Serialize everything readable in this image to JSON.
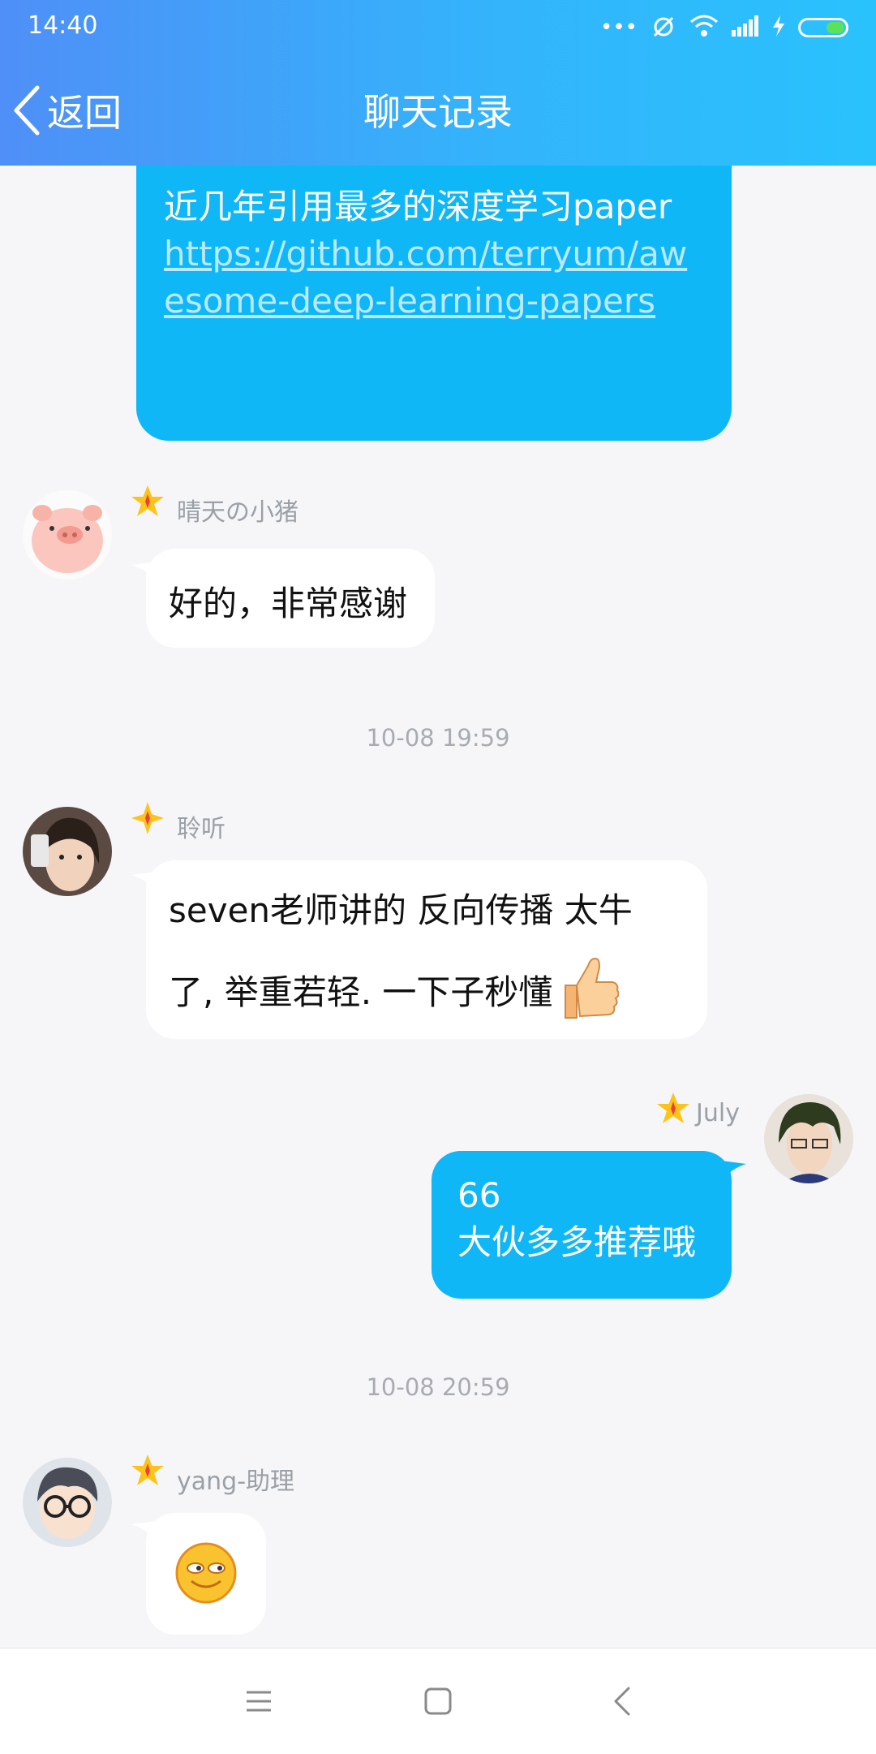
{
  "status_bar": {
    "time": "14:40"
  },
  "header": {
    "back_label": "返回",
    "title": "聊天记录"
  },
  "messages": {
    "top": {
      "text": "近几年引用最多的深度学习paper",
      "link": "https://github.com/terryum/awesome-deep-learning-papers"
    },
    "pig": {
      "sender": "晴天の小猪",
      "text": "好的，非常感谢"
    },
    "ts1": "10-08 19:59",
    "lingting": {
      "sender": "聆听",
      "line1": "seven老师讲的 反向传播 太牛",
      "line2": "了, 举重若轻. 一下子秒懂"
    },
    "july": {
      "sender": "July",
      "line1": "66",
      "line2": "大伙多多推荐哦"
    },
    "ts2": "10-08 20:59",
    "yang": {
      "sender": "yang-助理"
    }
  },
  "icons": {
    "star": "star-badge-icon",
    "thumbs_up": "thumbs-up-emoji",
    "smile": "smirk-emoji",
    "nav_menu": "menu-icon",
    "nav_home": "home-square-icon",
    "nav_back": "back-triangle-icon"
  },
  "colors": {
    "accent": "#10b7f6",
    "header_start": "#4f8ff7",
    "header_end": "#29c2fd"
  }
}
